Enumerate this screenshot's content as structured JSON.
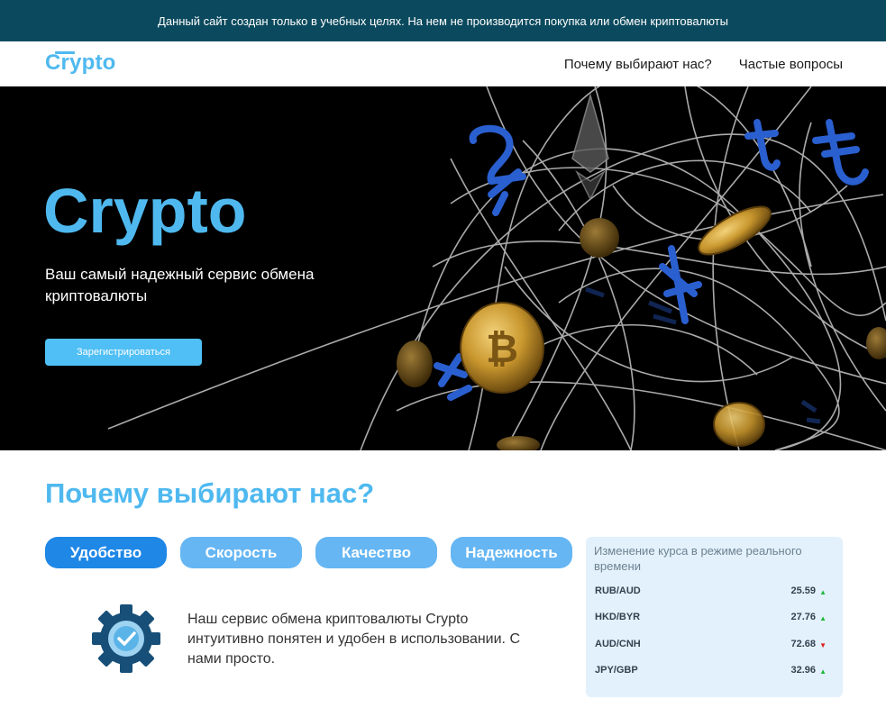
{
  "notice": "Данный сайт создан только в учебных целях. На нем не производится покупка или обмен криптовалюты",
  "header": {
    "logo": "Crypto",
    "nav": [
      "Почему выбирают нас?",
      "Частые вопросы"
    ]
  },
  "hero": {
    "title": "Crypto",
    "subtitle": "Ваш самый надежный сервис обмена криптовалюты",
    "button": "Зарегистрироваться"
  },
  "why": {
    "title": "Почему выбирают нас?",
    "tabs": [
      "Удобство",
      "Скорость",
      "Качество",
      "Надежность"
    ],
    "active_tab": "Удобство",
    "feature_icon": "gear-check-icon",
    "feature_text": "Наш сервис обмена криптовалюты Crypto интуитивно понятен и удобен в использовании. С нами просто."
  },
  "rates": {
    "title": "Изменение курса в режиме реального времени",
    "rows": [
      {
        "pair": "RUB/AUD",
        "value": "25.59",
        "trend": "▲"
      },
      {
        "pair": "HKD/BYR",
        "value": "27.76",
        "trend": "▲"
      },
      {
        "pair": "AUD/CNH",
        "value": "72.68",
        "trend": "▼"
      },
      {
        "pair": "JPY/GBP",
        "value": "32.96",
        "trend": "▲"
      }
    ]
  },
  "colors": {
    "accent": "#4fb9ef",
    "notice_bg": "#0b4a5e",
    "tab_active": "#1f87e6",
    "tab_inactive": "#65b6f3",
    "rates_bg": "#e3f1fc",
    "trend_up": "#1fb93c",
    "trend_down": "#e02020"
  }
}
